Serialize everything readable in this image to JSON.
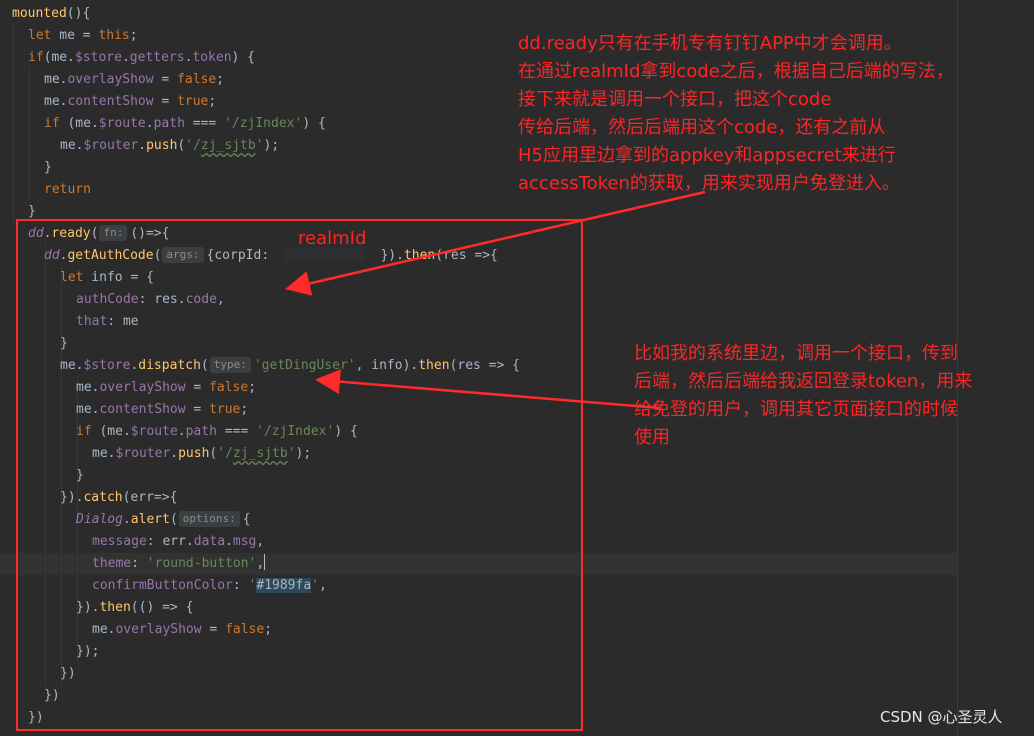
{
  "code_lines": [
    "mounted(){",
    "  let me = this;",
    "  if(me.$store.getters.token) {",
    "    me.overlayShow = false;",
    "    me.contentShow = true;",
    "    if (me.$route.path === '/zjIndex') {",
    "      me.$router.push('/zj_sjtb');",
    "    }",
    "    return",
    "  }",
    "  dd.ready( fn: ()=>{",
    "    dd.getAuthCode( args: {corpId:  ...  }).then(res =>{",
    "      let info = {",
    "        authCode: res.code,",
    "        that: me",
    "      }",
    "      me.$store.dispatch( type: 'getDingUser', info).then(res => {",
    "        me.overlayShow = false;",
    "        me.contentShow = true;",
    "        if (me.$route.path === '/zjIndex') {",
    "          me.$router.push('/zj_sjtb');",
    "        }",
    "      }).catch(err=>{",
    "        Dialog.alert( options: {",
    "          message: err.data.msg,",
    "          theme: 'round-button',",
    "          confirmButtonColor: '#1989fa',",
    "        }).then(() => {",
    "          me.overlayShow = false;",
    "        });",
    "      })",
    "    })",
    "  })"
  ],
  "inlay_hints": {
    "fn": "fn:",
    "args": "args:",
    "type": "type:",
    "options": "options:"
  },
  "annotations": {
    "top_note": "dd.ready只有在手机专有钉钉APP中才会调用。\n在通过realmId拿到code之后，根据自己后端的写法，\n接下来就是调用一个接口，把这个code\n传给后端，然后后端用这个code，还有之前从\nH5应用里边拿到的appkey和appsecret来进行\naccessToken的获取，用来实现用户免登进入。",
    "realm_label": "realmId",
    "right_note": "比如我的系统里边，调用一个接口，传到\n后端，然后后端给我返回登录token，用来\n给免登的用户，调用其它页面接口的时候\n使用"
  },
  "watermark": "CSDN @心圣灵人",
  "colors": {
    "background": "#2b2b2b",
    "keyword": "#cc7832",
    "field": "#9876aa",
    "function": "#ffc66d",
    "string": "#6a8759",
    "annotation": "#ff2424"
  }
}
